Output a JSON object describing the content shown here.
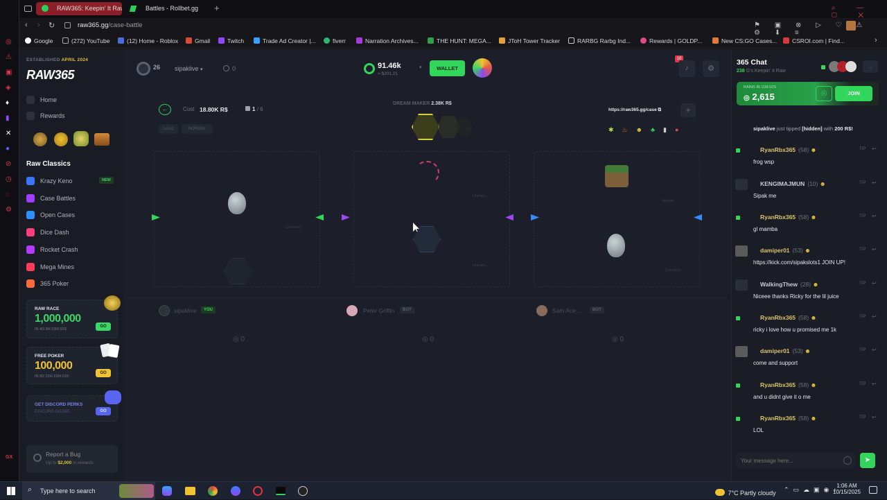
{
  "browser": {
    "tabs": [
      {
        "label": "RAW365: Keepin' It Raw",
        "active": true
      },
      {
        "label": "Battles - Rollbet.gg",
        "active": false
      }
    ],
    "url_host": "raw365.gg",
    "url_path": "/case-battle",
    "bookmarks": [
      "Google",
      "(272) YouTube",
      "(12) Home - Roblox",
      "Gmail",
      "Twitch",
      "Trade Ad Creator |...",
      "fiverr",
      "Narration Archives...",
      "THE HUNT: MEGA...",
      "JToH Tower Tracker",
      "RARBG Rarbg Ind...",
      "Rewards | GOLDP...",
      "New CS:GO Cases...",
      "CSROI.com | Find..."
    ]
  },
  "site": {
    "established": "ESTABLISHED",
    "established_date": "APRIL 2024",
    "logo": "RAW365",
    "nav": {
      "home": "Home",
      "rewards": "Rewards"
    },
    "raw_classics_title": "Raw Classics",
    "games": [
      {
        "label": "Krazy Keno",
        "badge": "NEW",
        "color": "#3d74ff"
      },
      {
        "label": "Case Battles",
        "color": "#a13dff"
      },
      {
        "label": "Open Cases",
        "color": "#2f8fff"
      },
      {
        "label": "Dice Dash",
        "color": "#ff3d7f"
      },
      {
        "label": "Rocket Crash",
        "color": "#b23dff"
      },
      {
        "label": "Mega Mines",
        "color": "#ff3d5a"
      },
      {
        "label": "365 Poker",
        "color": "#ff6a3d"
      }
    ],
    "raw_race": {
      "title": "RAW RACE",
      "amount": "1,000,000",
      "timer": "IN 4D 8H 53M 03S",
      "go": "GO"
    },
    "free_poker": {
      "title": "FREE POKER",
      "amount": "100,000",
      "timer": "IN 8D 22H 23M 03S",
      "go": "GO"
    },
    "discord": {
      "title": "GET DISCORD PERKS",
      "sub": "DISCORD.GG/365",
      "go": "GO"
    },
    "bug": {
      "title": "Report a Bug",
      "sub_prefix": "Up to",
      "amount": "$2,000",
      "sub_suffix": "in rewards"
    }
  },
  "header": {
    "level": "26",
    "username": "sipaklive",
    "small_balance": "0",
    "balance": "91.46k",
    "balance_usd": "≈ $201.21",
    "wallet": "WALLET",
    "notif_count": "10"
  },
  "battle": {
    "cost_label": "Cost",
    "cost_value": "18.80K R$",
    "cases_count": "1",
    "cases_total": "/ 6",
    "mode": "1v1v1",
    "type": "NORMAL",
    "dream_maker_label": "DREAM MAKER",
    "dream_maker_value": "2.38K R$",
    "share_url": "https://raw365.gg/case",
    "players": [
      {
        "name": "sipaklive",
        "badge": "YOU",
        "total": "0"
      },
      {
        "name": "Peter Griffin",
        "badge": "BOT",
        "total": "0"
      },
      {
        "name": "Sam Ace ...",
        "badge": "BOT",
        "total": "0"
      }
    ],
    "slot_labels": [
      "Common",
      "Uncom...",
      "Uncom...",
      "Uncom...",
      "Common"
    ]
  },
  "chat": {
    "title": "365 Chat",
    "online_count": "238",
    "online_label": "G's Keepin' It Raw",
    "rains_label": "RAINS IN 11M 02S",
    "rain_amount": "2,615",
    "join": "JOIN",
    "tip_label": "TIP",
    "tip_message_name": "sipaklive",
    "tip_message_middle": "just tipped",
    "tip_message_hidden": "[hidden]",
    "tip_message_with": "with",
    "tip_message_amount": "200 R$!",
    "messages": [
      {
        "name": "RyanRbx365",
        "level": "(58)",
        "text": "frog wsp"
      },
      {
        "name": "KENGIMAJMUN",
        "level": "(10)",
        "text": "Sipak me"
      },
      {
        "name": "RyanRbx365",
        "level": "(58)",
        "text": "gl mamba"
      },
      {
        "name": "damiper01",
        "level": "(53)",
        "text": "https://kick.com/sipakslots1 JOIN UP!"
      },
      {
        "name": "WalkingThew",
        "level": "(28)",
        "text": "Niceee thanks Ricky for the lil juice"
      },
      {
        "name": "RyanRbx365",
        "level": "(58)",
        "text": "ricky i love how u promised me 1k"
      },
      {
        "name": "damiper01",
        "level": "(53)",
        "text": "come and support"
      },
      {
        "name": "RyanRbx365",
        "level": "(58)",
        "text": "and u didnt give it o me"
      },
      {
        "name": "RyanRbx365",
        "level": "(58)",
        "text": "LOL"
      }
    ],
    "input_placeholder": "Your message here..."
  },
  "taskbar": {
    "search_placeholder": "Type here to search",
    "weather": "7°C  Partly cloudy",
    "time": "1:06 AM",
    "date": "10/15/2025"
  }
}
